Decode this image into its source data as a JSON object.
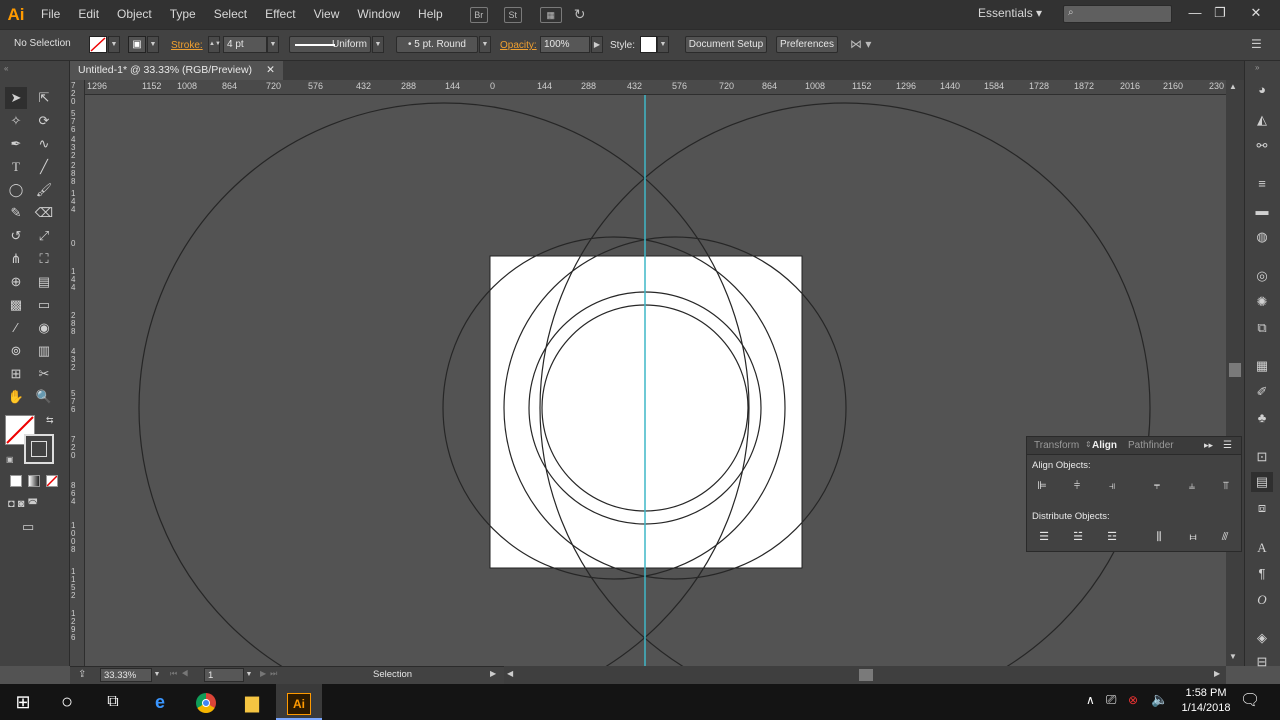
{
  "app": {
    "logo": "Ai"
  },
  "menu": [
    "File",
    "Edit",
    "Object",
    "Type",
    "Select",
    "Effect",
    "View",
    "Window",
    "Help"
  ],
  "menubar_icons": {
    "br": "Br",
    "st": "St"
  },
  "workspace": {
    "label": "Essentials",
    "arrow": "▾"
  },
  "window_controls": {
    "minimize": "—",
    "restore": "❐",
    "close": "✕"
  },
  "control": {
    "selection": "No Selection",
    "stroke_label": "Stroke:",
    "stroke_value": "4 pt",
    "profile": "Uniform",
    "brush": "5 pt. Round",
    "opacity_label": "Opacity:",
    "opacity_value": "100%",
    "style_label": "Style:",
    "document_setup": "Document Setup",
    "preferences": "Preferences"
  },
  "document_tab": {
    "title": "Untitled-1* @ 33.33% (RGB/Preview)",
    "close": "✕"
  },
  "ruler_h": [
    "1296",
    "1152",
    "1008",
    "864",
    "720",
    "576",
    "432",
    "288",
    "144",
    "0",
    "144",
    "288",
    "432",
    "576",
    "720",
    "864",
    "1008",
    "1152",
    "1296",
    "1440",
    "1584",
    "1728",
    "1872",
    "2016",
    "2160",
    "230"
  ],
  "ruler_v": [
    "7 2 0",
    "5 7 6",
    "4 3 2",
    "2 8 8",
    "1 4 4",
    "0",
    "1 4 4",
    "2 8 8",
    "4 3 2",
    "5 7 6",
    "7 2 0",
    "8 6 4",
    "1 0 0 8",
    "1 1 5 2",
    "1 2 9 6"
  ],
  "status": {
    "zoom": "33.33%",
    "artboard": "1",
    "tool": "Selection"
  },
  "align_panel": {
    "tabs": [
      "Transform",
      "Align",
      "Pathfinder"
    ],
    "align_objects": "Align Objects:",
    "distribute_objects": "Distribute Objects:"
  },
  "taskbar": {
    "time": "1:58 PM",
    "date": "1/14/2018",
    "ai_app": "Ai"
  },
  "colors": {
    "guide": "#3fb7c7",
    "accent": "#ff9a00",
    "artboard": "#ffffff",
    "pasteboard": "#535353"
  }
}
